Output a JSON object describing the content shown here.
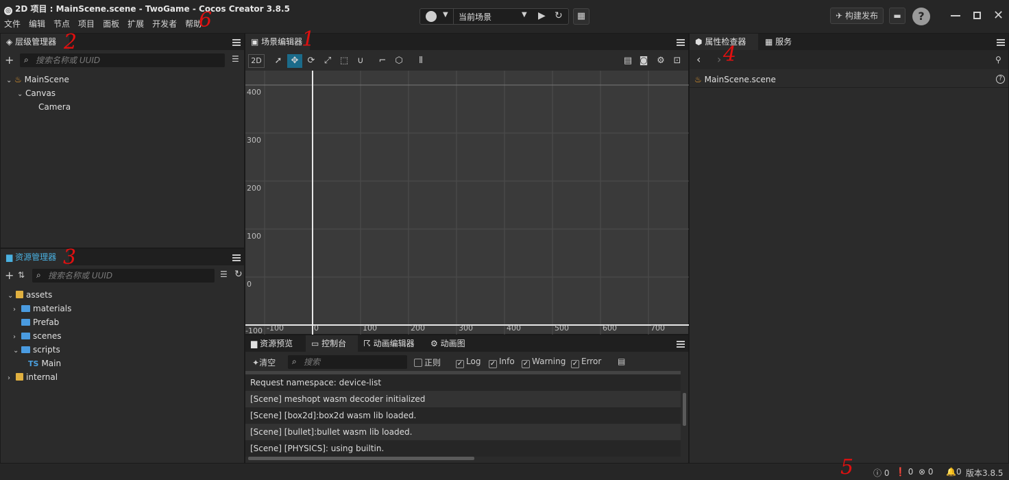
{
  "window": {
    "title": "2D 项目 : MainScene.scene - TwoGame - Cocos Creator 3.8.5",
    "menu": [
      "文件",
      "编辑",
      "节点",
      "项目",
      "面板",
      "扩展",
      "开发者",
      "帮助"
    ],
    "scene_select": "当前场景",
    "build_button": "构建发布"
  },
  "hierarchy": {
    "title": "层级管理器",
    "search_placeholder": "搜索名称或 UUID",
    "nodes": [
      "MainScene",
      "Canvas",
      "Camera"
    ]
  },
  "assets": {
    "title": "资源管理器",
    "search_placeholder": "搜索名称或 UUID",
    "items": [
      "assets",
      "materials",
      "Prefab",
      "scenes",
      "scripts",
      "Main",
      "internal"
    ],
    "ts_tag": "TS"
  },
  "scene_editor": {
    "title": "场景编辑器",
    "mode_2d": "2D",
    "y_ticks": [
      "400",
      "300",
      "200",
      "100",
      "0",
      "-100"
    ],
    "x_ticks": [
      "-100",
      "0",
      "100",
      "200",
      "300",
      "400",
      "500",
      "600",
      "700"
    ]
  },
  "bottom_panel": {
    "tabs": [
      "资源预览",
      "控制台",
      "动画编辑器",
      "动画图"
    ],
    "clear_label": "清空",
    "search_placeholder": "搜索",
    "regex_label": "正则",
    "filters": [
      "Log",
      "Info",
      "Warning",
      "Error"
    ],
    "logs": [
      "Request namespace: device-list",
      "[Scene] meshopt wasm decoder initialized",
      "[Scene] [box2d]:box2d wasm lib loaded.",
      "[Scene] [bullet]:bullet wasm lib loaded.",
      "[Scene] [PHYSICS]: using builtin."
    ]
  },
  "inspector": {
    "tabs": [
      "属性检查器",
      "服务"
    ],
    "asset_name": "MainScene.scene"
  },
  "statusbar": {
    "info_count": "0",
    "warn_count": "0",
    "error_count": "0",
    "notify_count": "0",
    "version": "版本3.8.5"
  },
  "annotations": [
    "1",
    "2",
    "3",
    "4",
    "5",
    "6"
  ],
  "colors": {
    "accent": "#1b6b8a",
    "annotation": "#e01010",
    "selected_tab": "#2b2b2b"
  }
}
